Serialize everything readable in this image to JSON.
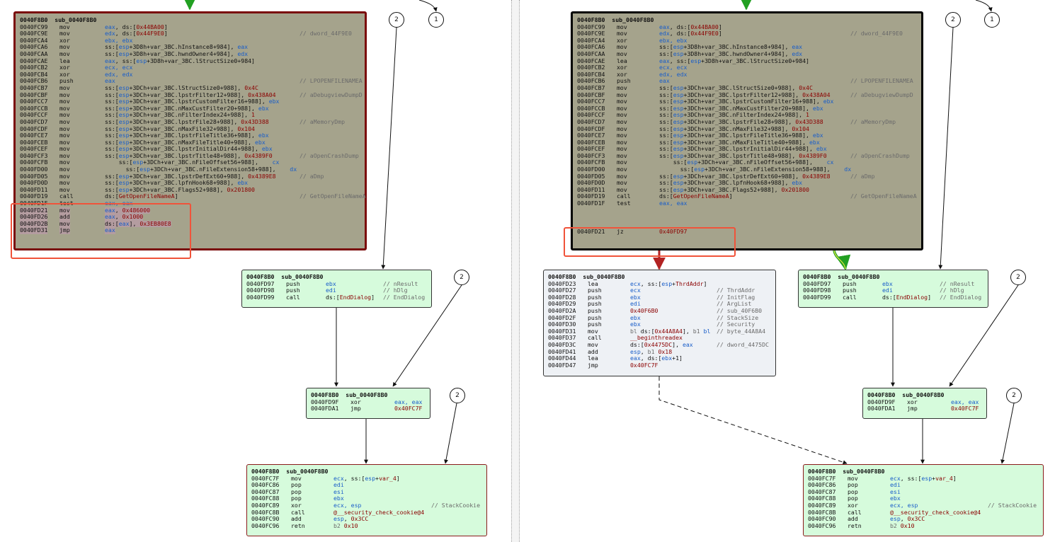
{
  "blocks": {
    "main": {
      "header": [
        "0040F8B0",
        "sub_0040F8B0"
      ],
      "lines": [
        [
          "0040FC99",
          "mov",
          [
            [
              "eax",
              "reg"
            ],
            [
              ", ds:[",
              ""
            ],
            [
              "0x44BA00",
              "num"
            ],
            [
              "]",
              ""
            ]
          ],
          ""
        ],
        [
          "0040FC9E",
          "mov",
          [
            [
              "edx",
              "reg"
            ],
            [
              ", ds:[",
              ""
            ],
            [
              "0x44F9E0",
              "num"
            ],
            [
              "]",
              ""
            ]
          ],
          "// dword_44F9E0"
        ],
        [
          "0040FCA4",
          "xor",
          [
            [
              "ebx, ebx",
              "reg"
            ]
          ],
          ""
        ],
        [
          "0040FCA6",
          "mov",
          [
            [
              "ss:[",
              ""
            ],
            [
              "esp",
              "reg"
            ],
            [
              "+3D8h+var_3BC.hInstance8+984]",
              ""
            ],
            [
              ", ",
              ""
            ],
            [
              "eax",
              "reg"
            ]
          ],
          ""
        ],
        [
          "0040FCAA",
          "mov",
          [
            [
              "ss:[",
              ""
            ],
            [
              "esp",
              "reg"
            ],
            [
              "+3D8h+var_3BC.hwndOwner4+984]",
              ""
            ],
            [
              ", ",
              ""
            ],
            [
              "edx",
              "reg"
            ]
          ],
          ""
        ],
        [
          "0040FCAE",
          "lea",
          [
            [
              "eax",
              "reg"
            ],
            [
              ", ss:[",
              ""
            ],
            [
              "esp",
              "reg"
            ],
            [
              "+3D8h+var_3BC.lStructSize0+984]",
              ""
            ]
          ],
          ""
        ],
        [
          "0040FCB2",
          "xor",
          [
            [
              "ecx, ecx",
              "reg"
            ]
          ],
          ""
        ],
        [
          "0040FCB4",
          "xor",
          [
            [
              "edx, edx",
              "reg"
            ]
          ],
          ""
        ],
        [
          "0040FCB6",
          "push",
          [
            [
              "eax",
              "reg"
            ]
          ],
          "// LPOPENFILENAMEA"
        ],
        [
          "0040FCB7",
          "mov",
          [
            [
              "ss:[",
              ""
            ],
            [
              "esp",
              "reg"
            ],
            [
              "+3DCh+var_3BC.lStructSize0+988], ",
              ""
            ],
            [
              "0x4C",
              "num"
            ]
          ],
          ""
        ],
        [
          "0040FCBF",
          "mov",
          [
            [
              "ss:[",
              ""
            ],
            [
              "esp",
              "reg"
            ],
            [
              "+3DCh+var_3BC.lpstrFilter12+988], ",
              ""
            ],
            [
              "0x438A04",
              "num"
            ]
          ],
          "// aDebugviewDumpD"
        ],
        [
          "0040FCC7",
          "mov",
          [
            [
              "ss:[",
              ""
            ],
            [
              "esp",
              "reg"
            ],
            [
              "+3DCh+var_3BC.lpstrCustomFilter16+988], ",
              ""
            ],
            [
              "ebx",
              "reg"
            ]
          ],
          ""
        ],
        [
          "0040FCCB",
          "mov",
          [
            [
              "ss:[",
              ""
            ],
            [
              "esp",
              "reg"
            ],
            [
              "+3DCh+var_3BC.nMaxCustFilter20+988], ",
              ""
            ],
            [
              "ebx",
              "reg"
            ]
          ],
          ""
        ],
        [
          "0040FCCF",
          "mov",
          [
            [
              "ss:[",
              ""
            ],
            [
              "esp",
              "reg"
            ],
            [
              "+3DCh+var_3BC.nFilterIndex24+988], ",
              ""
            ],
            [
              "1",
              "num"
            ]
          ],
          ""
        ],
        [
          "0040FCD7",
          "mov",
          [
            [
              "ss:[",
              ""
            ],
            [
              "esp",
              "reg"
            ],
            [
              "+3DCh+var_3BC.lpstrFile28+988], ",
              ""
            ],
            [
              "0x43D388",
              "num"
            ]
          ],
          "// aMemoryDmp"
        ],
        [
          "0040FCDF",
          "mov",
          [
            [
              "ss:[",
              ""
            ],
            [
              "esp",
              "reg"
            ],
            [
              "+3DCh+var_3BC.nMaxFile32+988], ",
              ""
            ],
            [
              "0x104",
              "num"
            ]
          ],
          ""
        ],
        [
          "0040FCE7",
          "mov",
          [
            [
              "ss:[",
              ""
            ],
            [
              "esp",
              "reg"
            ],
            [
              "+3DCh+var_3BC.lpstrFileTitle36+988], ",
              ""
            ],
            [
              "ebx",
              "reg"
            ]
          ],
          ""
        ],
        [
          "0040FCEB",
          "mov",
          [
            [
              "ss:[",
              ""
            ],
            [
              "esp",
              "reg"
            ],
            [
              "+3DCh+var_3BC.nMaxFileTitle40+988], ",
              ""
            ],
            [
              "ebx",
              "reg"
            ]
          ],
          ""
        ],
        [
          "0040FCEF",
          "mov",
          [
            [
              "ss:[",
              ""
            ],
            [
              "esp",
              "reg"
            ],
            [
              "+3DCh+var_3BC.lpstrInitialDir44+988], ",
              ""
            ],
            [
              "ebx",
              "reg"
            ]
          ],
          ""
        ],
        [
          "0040FCF3",
          "mov",
          [
            [
              "ss:[",
              ""
            ],
            [
              "esp",
              "reg"
            ],
            [
              "+3DCh+var_3BC.lpstrTitle48+988], ",
              ""
            ],
            [
              "0x4389F0",
              "num"
            ]
          ],
          "// aOpenCrashDump"
        ],
        [
          "0040FCFB",
          "mov",
          [
            [
              "    ss:[",
              ""
            ],
            [
              "esp",
              "reg"
            ],
            [
              "+3DCh+var_3BC.nFileOffset56+988],    ",
              ""
            ],
            [
              "cx",
              "reg"
            ]
          ],
          ""
        ],
        [
          "0040FD00",
          "mov",
          [
            [
              "      ss:[",
              ""
            ],
            [
              "esp",
              "reg"
            ],
            [
              "+3DCh+var_3BC.nFileExtension58+988],    ",
              ""
            ],
            [
              "dx",
              "reg"
            ]
          ],
          ""
        ],
        [
          "0040FD05",
          "mov",
          [
            [
              "ss:[",
              ""
            ],
            [
              "esp",
              "reg"
            ],
            [
              "+3DCh+var_3BC.lpstrDefExt60+988], ",
              ""
            ],
            [
              "0x4389E8",
              "num"
            ]
          ],
          "// aDmp"
        ],
        [
          "0040FD0D",
          "mov",
          [
            [
              "ss:[",
              ""
            ],
            [
              "esp",
              "reg"
            ],
            [
              "+3DCh+var_3BC.lpfnHook68+988], ",
              ""
            ],
            [
              "ebx",
              "reg"
            ]
          ],
          ""
        ],
        [
          "0040FD11",
          "mov",
          [
            [
              "ss:[",
              ""
            ],
            [
              "esp",
              "reg"
            ],
            [
              "+3DCh+var_3BC.Flags52+988], ",
              ""
            ],
            [
              "0x201800",
              "num"
            ]
          ],
          ""
        ],
        [
          "0040FD19",
          "call",
          [
            [
              "ds:[",
              ""
            ],
            [
              "GetOpenFileNameA",
              "num"
            ],
            [
              "]",
              ""
            ]
          ],
          "// GetOpenFileNameA"
        ],
        [
          "0040FD1F",
          "test",
          [
            [
              "eax, eax",
              "reg"
            ]
          ],
          ""
        ]
      ],
      "left_tail": [
        [
          "0040FD21",
          "mov",
          [
            [
              "eax",
              "reg"
            ],
            [
              ", ",
              ""
            ],
            [
              "0x486000",
              "num"
            ]
          ],
          ""
        ],
        [
          "0040FD26",
          "add",
          [
            [
              "eax",
              "reg"
            ],
            [
              ", ",
              ""
            ],
            [
              "0x1000",
              "num"
            ]
          ],
          ""
        ],
        [
          "0040FD2B",
          "mov",
          [
            [
              "ds:[",
              ""
            ],
            [
              "eax",
              "reg"
            ],
            [
              "], ",
              ""
            ],
            [
              "0x3EB80E8",
              "num"
            ]
          ],
          ""
        ],
        [
          "0040FD31",
          "jmp",
          [
            [
              "eax",
              "reg"
            ]
          ],
          ""
        ]
      ],
      "right_tail": [
        [
          "0040FD21",
          "jz",
          [
            [
              "0x40FD97",
              "num"
            ]
          ],
          ""
        ]
      ]
    },
    "enddialog": {
      "header": [
        "0040F8B0",
        "sub_0040F8B0"
      ],
      "lines": [
        [
          "0040FD97",
          "push",
          [
            [
              "ebx",
              "reg"
            ]
          ],
          "// nResult"
        ],
        [
          "0040FD98",
          "push",
          [
            [
              "edi",
              "reg"
            ]
          ],
          "// hDlg"
        ],
        [
          "0040FD99",
          "call",
          [
            [
              "ds:[",
              ""
            ],
            [
              "EndDialog",
              "num"
            ],
            [
              "]",
              ""
            ]
          ],
          "// EndDialog"
        ]
      ]
    },
    "xorblock": {
      "header": [
        "0040F8B0",
        "sub_0040F8B0"
      ],
      "lines": [
        [
          "0040FD9F",
          "xor",
          [
            [
              "eax, eax",
              "reg"
            ]
          ],
          ""
        ],
        [
          "0040FDA1",
          "jmp",
          [
            [
              "0x40FC7F",
              "num"
            ]
          ],
          ""
        ]
      ]
    },
    "epilogue": {
      "header": [
        "0040F8B0",
        "sub_0040F8B0"
      ],
      "lines": [
        [
          "0040FC7F",
          "mov",
          [
            [
              "ecx",
              "reg"
            ],
            [
              ", ss:[",
              ""
            ],
            [
              "esp",
              "reg"
            ],
            [
              "+",
              ""
            ],
            [
              "var_4",
              "num"
            ],
            [
              "]",
              ""
            ]
          ],
          ""
        ],
        [
          "0040FC86",
          "pop",
          [
            [
              "edi",
              "reg"
            ]
          ],
          ""
        ],
        [
          "0040FC87",
          "pop",
          [
            [
              "esi",
              "reg"
            ]
          ],
          ""
        ],
        [
          "0040FC88",
          "pop",
          [
            [
              "ebx",
              "reg"
            ]
          ],
          ""
        ],
        [
          "0040FC89",
          "xor",
          [
            [
              "ecx, esp",
              "reg"
            ]
          ],
          "// StackCookie"
        ],
        [
          "0040FC8B",
          "call",
          [
            [
              "@__security_check_cookie@4",
              "num"
            ]
          ],
          ""
        ],
        [
          "0040FC90",
          "add",
          [
            [
              "esp",
              "reg"
            ],
            [
              ", ",
              ""
            ],
            [
              "0x3CC",
              "num"
            ]
          ],
          ""
        ],
        [
          "0040FC96",
          "retn",
          [
            [
              "b2 ",
              "cmt"
            ],
            [
              "0x10",
              "num"
            ]
          ],
          ""
        ]
      ]
    },
    "thread": {
      "header": [
        "0040F8B0",
        "sub_0040F8B0"
      ],
      "lines": [
        [
          "0040FD23",
          "lea",
          [
            [
              "ecx",
              "reg"
            ],
            [
              ", ss:[",
              ""
            ],
            [
              "esp",
              "reg"
            ],
            [
              "+",
              ""
            ],
            [
              "ThrdAddr",
              "num"
            ],
            [
              "]",
              ""
            ]
          ],
          ""
        ],
        [
          "0040FD27",
          "push",
          [
            [
              "ecx",
              "reg"
            ]
          ],
          "// ThrdAddr"
        ],
        [
          "0040FD28",
          "push",
          [
            [
              "ebx",
              "reg"
            ]
          ],
          "// InitFlag"
        ],
        [
          "0040FD29",
          "push",
          [
            [
              "edi",
              "reg"
            ]
          ],
          "// ArgList"
        ],
        [
          "0040FD2A",
          "push",
          [
            [
              "0x40F6B0",
              "num"
            ]
          ],
          "// sub_40F6B0"
        ],
        [
          "0040FD2F",
          "push",
          [
            [
              "ebx",
              "reg"
            ]
          ],
          "// StackSize"
        ],
        [
          "0040FD30",
          "push",
          [
            [
              "ebx",
              "reg"
            ]
          ],
          "// Security"
        ],
        [
          "0040FD31",
          "mov",
          [
            [
              "bl ",
              "cmt"
            ],
            [
              "ds:[",
              ""
            ],
            [
              "0x44A8A4",
              "num"
            ],
            [
              "], ",
              ""
            ],
            [
              "b1 ",
              "cmt"
            ],
            [
              "bl",
              "reg"
            ]
          ],
          "// byte_44A8A4"
        ],
        [
          "0040FD37",
          "call",
          [
            [
              "__beginthreadex",
              "num"
            ]
          ],
          ""
        ],
        [
          "0040FD3C",
          "mov",
          [
            [
              "ds:[",
              ""
            ],
            [
              "0x4475DC",
              "num"
            ],
            [
              "], ",
              ""
            ],
            [
              "eax",
              "reg"
            ]
          ],
          "// dword_4475DC"
        ],
        [
          "0040FD41",
          "add",
          [
            [
              "esp",
              "reg"
            ],
            [
              ", ",
              ""
            ],
            [
              "b1 ",
              "cmt"
            ],
            [
              "0x18",
              "num"
            ]
          ],
          ""
        ],
        [
          "0040FD44",
          "lea",
          [
            [
              "eax",
              "reg"
            ],
            [
              ", ds:[",
              ""
            ],
            [
              "ebx",
              "reg"
            ],
            [
              "+1]",
              ""
            ]
          ],
          ""
        ],
        [
          "0040FD47",
          "jmp",
          [
            [
              "0x40FC7F",
              "num"
            ]
          ],
          ""
        ]
      ]
    }
  },
  "badges": {
    "two": "2",
    "one": "1"
  },
  "colors": {
    "main_bg": "#a5a38c",
    "block_green": "#d6fbdc",
    "block_grey": "#eef1f5",
    "highlight": "#f0533a",
    "edge_true": "#22a022",
    "edge_false": "#b22222",
    "register": "#1a5ec9",
    "immediate": "#8b0000"
  }
}
